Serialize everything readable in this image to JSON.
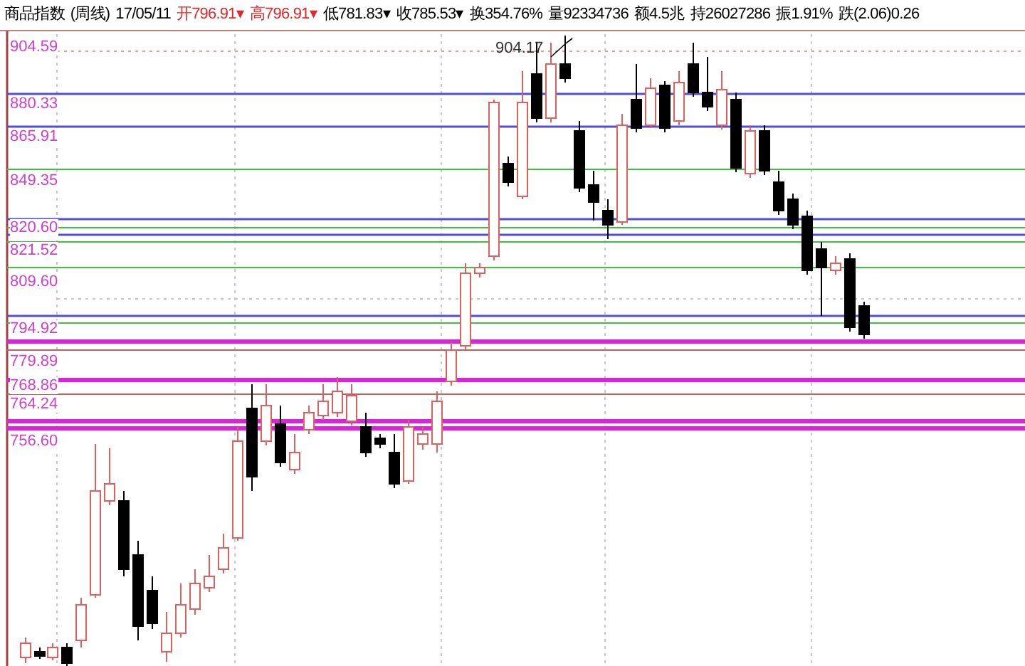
{
  "header": {
    "name": "商品指数",
    "period": "(周线)",
    "date": "17/05/11",
    "fields": [
      {
        "label": "开",
        "value": "796.91",
        "arrow": "▾",
        "color": "#e02828"
      },
      {
        "label": "高",
        "value": "796.91",
        "arrow": "▾",
        "color": "#e02828"
      },
      {
        "label": "低",
        "value": "781.83",
        "arrow": "▾",
        "color": "#000000"
      },
      {
        "label": "收",
        "value": "785.53",
        "arrow": "▾",
        "color": "#000000"
      },
      {
        "label": "换",
        "value": "354.76%",
        "color": "#000000"
      },
      {
        "label": "量",
        "value": "92334736",
        "color": "#000000"
      },
      {
        "label": "额",
        "value": "4.5兆",
        "color": "#000000"
      },
      {
        "label": "持",
        "value": "26027286",
        "color": "#000000"
      },
      {
        "label": "振",
        "value": "1.91%",
        "color": "#000000"
      },
      {
        "label": "跌",
        "value": "(2.06)0.26",
        "color": "#000000"
      }
    ]
  },
  "price_labels": [
    "904.59",
    "880.33",
    "865.91",
    "849.35",
    "820.60",
    "821.52",
    "809.60",
    "794.92",
    "779.89",
    "768.86",
    "764.24",
    "756.60"
  ],
  "high_marker": "904.17"
}
